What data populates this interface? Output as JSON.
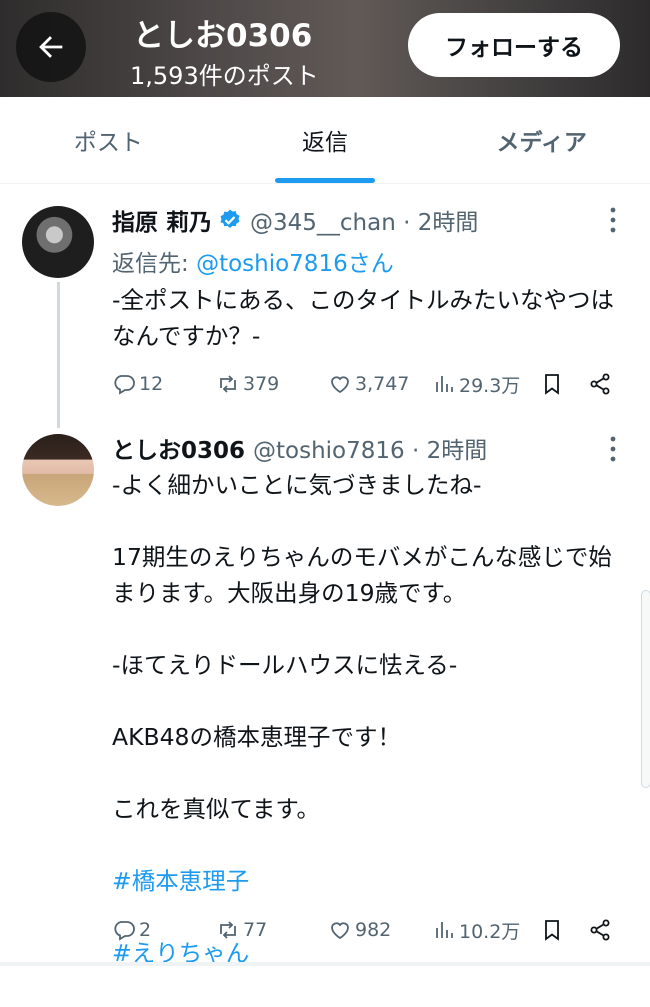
{
  "header": {
    "name": "としお0306",
    "post_count": "1,593件のポスト",
    "follow_label": "フォローする"
  },
  "tabs": [
    {
      "label": "ポスト"
    },
    {
      "label": "返信"
    },
    {
      "label": "メディア"
    }
  ],
  "tweets": [
    {
      "name": "指原 莉乃",
      "handle": "@345__chan · 2時間",
      "reply_prefix": "返信先: ",
      "reply_mention": "@toshio7816さん",
      "text": "-全ポストにある、このタイトルみたいなやつはなんですか？-",
      "replies": "12",
      "reposts": "379",
      "likes": "3,747",
      "views": "29.3万"
    },
    {
      "name": "としお0306",
      "handle": "@toshio7816 · 2時間",
      "text": "-よく細かいことに気づきましたね-\n\n17期生のえりちゃんのモバメがこんな感じで始まります。大阪出身の19歳です。\n\n-ほてえりドールハウスに怯える-\n\nAKB48の橋本恵理子です！\n\nこれを真似てます。",
      "hashtags": [
        "#橋本恵理子",
        "#えりちゃん"
      ],
      "replies": "2",
      "reposts": "77",
      "likes": "982",
      "views": "10.2万"
    }
  ],
  "colors": {
    "accent": "#1d9bf0",
    "text": "#0f1419",
    "muted": "#536471"
  }
}
